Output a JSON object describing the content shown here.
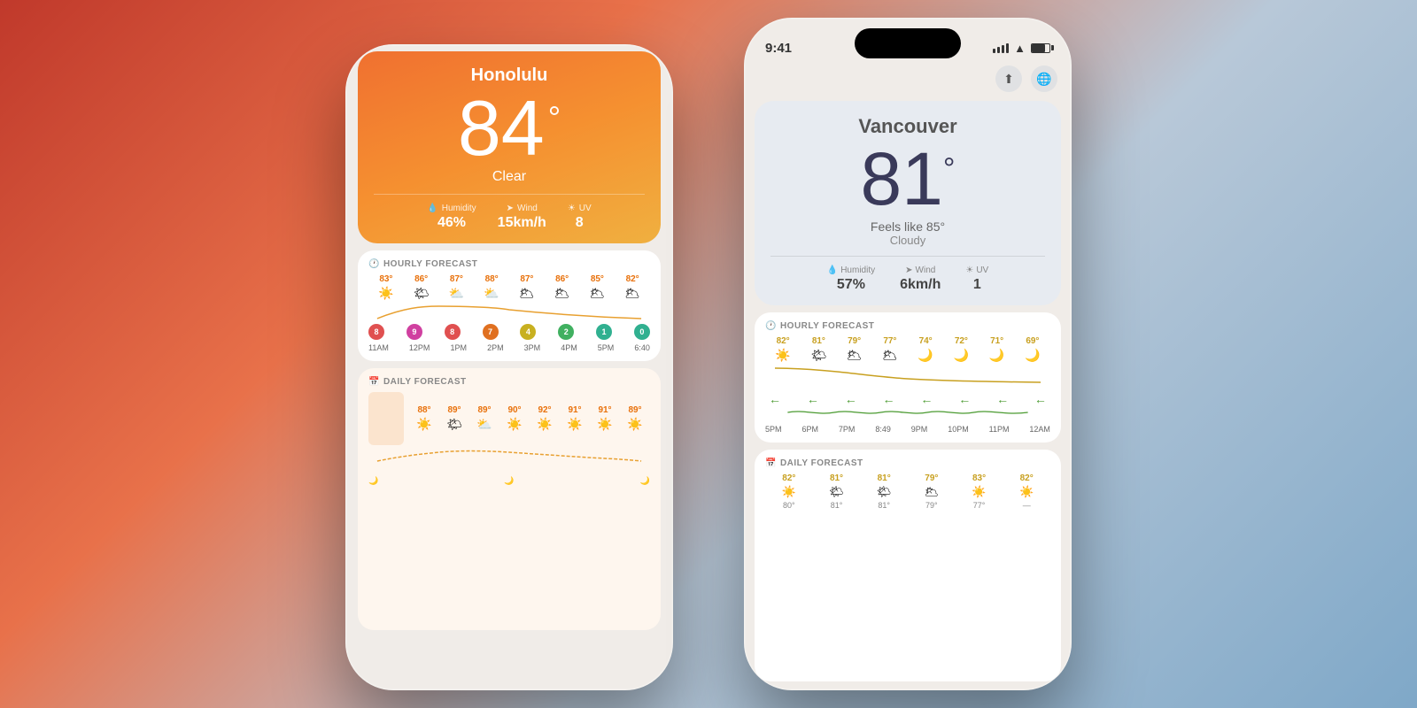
{
  "left_phone": {
    "city": "Honolulu",
    "temp": "84",
    "temp_unit": "°",
    "condition": "Clear",
    "humidity_label": "Humidity",
    "humidity_value": "46%",
    "wind_label": "Wind",
    "wind_value": "15km/h",
    "uv_label": "UV",
    "uv_value": "8",
    "hourly_title": "HOURLY FORECAST",
    "hourly": [
      {
        "time": "11AM",
        "temp": "83°",
        "icon": "☀️",
        "uv": "8",
        "uv_class": "uv-red"
      },
      {
        "time": "12PM",
        "temp": "86°",
        "icon": "🌤",
        "uv": "9",
        "uv_class": "uv-red"
      },
      {
        "time": "1PM",
        "temp": "87°",
        "icon": "⛅",
        "uv": "8",
        "uv_class": "uv-red"
      },
      {
        "time": "2PM",
        "temp": "88°",
        "icon": "⛅",
        "uv": "7",
        "uv_class": "uv-orange"
      },
      {
        "time": "3PM",
        "temp": "87°",
        "icon": "🌥",
        "uv": "4",
        "uv_class": "uv-yellow"
      },
      {
        "time": "4PM",
        "temp": "86°",
        "icon": "🌥",
        "uv": "2",
        "uv_class": "uv-green"
      },
      {
        "time": "5PM",
        "temp": "85°",
        "icon": "🌥",
        "uv": "1",
        "uv_class": "uv-teal"
      },
      {
        "time": "6:40",
        "temp": "82°",
        "icon": "🌥",
        "uv": "0",
        "uv_class": "uv-teal"
      }
    ],
    "daily_title": "DAILY FORECAST",
    "daily": [
      {
        "icon": "☀️",
        "temp": "88°"
      },
      {
        "icon": "🌤",
        "temp": "89°"
      },
      {
        "icon": "⛅",
        "temp": "89°"
      },
      {
        "icon": "☀️",
        "temp": "90°"
      },
      {
        "icon": "☀️",
        "temp": "92°"
      },
      {
        "icon": "☀️",
        "temp": "91°"
      },
      {
        "icon": "☀️",
        "temp": "91°"
      },
      {
        "icon": "☀️",
        "temp": "89°"
      }
    ]
  },
  "right_phone": {
    "status_time": "9:41",
    "city": "Vancouver",
    "temp": "81",
    "temp_unit": "°",
    "feels_like": "Feels like 85°",
    "condition": "Cloudy",
    "humidity_label": "Humidity",
    "humidity_value": "57%",
    "wind_label": "Wind",
    "wind_value": "6km/h",
    "uv_label": "UV",
    "uv_value": "1",
    "hourly_title": "HOURLY FORECAST",
    "hourly": [
      {
        "time": "5PM",
        "temp": "82°",
        "icon": "☀️"
      },
      {
        "time": "6PM",
        "temp": "81°",
        "icon": "🌤"
      },
      {
        "time": "7PM",
        "temp": "79°",
        "icon": "🌥"
      },
      {
        "time": "8:49",
        "temp": "77°",
        "icon": "🌥"
      },
      {
        "time": "9PM",
        "temp": "74°",
        "icon": "🌙"
      },
      {
        "time": "10PM",
        "temp": "72°",
        "icon": "🌙"
      },
      {
        "time": "11PM",
        "temp": "71°",
        "icon": "🌙"
      },
      {
        "time": "12AM",
        "temp": "69°",
        "icon": "🌙"
      }
    ],
    "daily_title": "DAILY FORECAST",
    "daily": [
      {
        "icon": "☀️",
        "temp": "82°"
      },
      {
        "icon": "🌤",
        "temp": "81°"
      },
      {
        "icon": "🌤",
        "temp": "81°"
      },
      {
        "icon": "🌥",
        "temp": "79°"
      },
      {
        "icon": "☀️",
        "temp": "83°"
      },
      {
        "icon": "☀️",
        "temp": "82°"
      }
    ],
    "toolbar": {
      "share_label": "⬆",
      "globe_label": "🌐"
    }
  }
}
